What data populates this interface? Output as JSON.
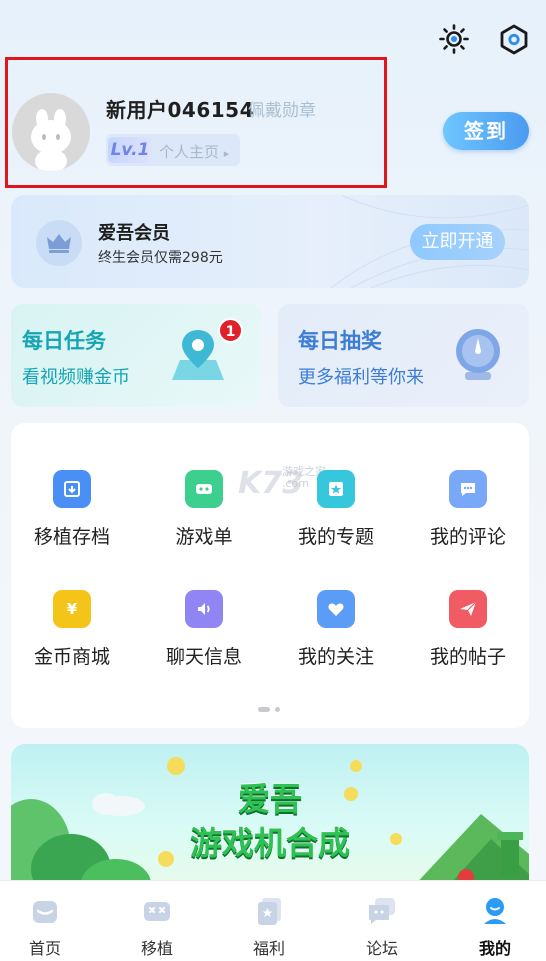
{
  "header": {
    "icons": [
      "sun-settings-icon",
      "hexagon-settings-icon"
    ]
  },
  "profile": {
    "username": "新用户046154",
    "badge_link": "佩戴勋章",
    "level": "Lv.1",
    "homepage_link": "个人主页",
    "checkin_label": "签到"
  },
  "membership": {
    "title": "爱吾会员",
    "subtitle": "终生会员仅需298元",
    "button": "立即开通"
  },
  "daily": {
    "task_title": "每日任务",
    "task_sub": "看视频赚金币",
    "task_badge": "1",
    "lottery_title": "每日抽奖",
    "lottery_sub": "更多福利等你来"
  },
  "watermark": {
    "main": "K73",
    "small": "游戏之家\n.com"
  },
  "menu": {
    "items": [
      {
        "label": "移植存档",
        "color": "#4a8ff5"
      },
      {
        "label": "游戏单",
        "color": "#3ccf8e"
      },
      {
        "label": "我的专题",
        "color": "#36c7dc"
      },
      {
        "label": "我的评论",
        "color": "#79a8f8"
      },
      {
        "label": "金币商城",
        "color": "#f5c419"
      },
      {
        "label": "聊天信息",
        "color": "#8f86f3"
      },
      {
        "label": "我的关注",
        "color": "#5b9cf6"
      },
      {
        "label": "我的帖子",
        "color": "#f15b63"
      }
    ]
  },
  "banner": {
    "line1": "爱吾",
    "line2": "游戏机合成"
  },
  "nav": {
    "items": [
      {
        "label": "首页"
      },
      {
        "label": "移植"
      },
      {
        "label": "福利"
      },
      {
        "label": "论坛"
      },
      {
        "label": "我的"
      }
    ],
    "active": "我的"
  }
}
